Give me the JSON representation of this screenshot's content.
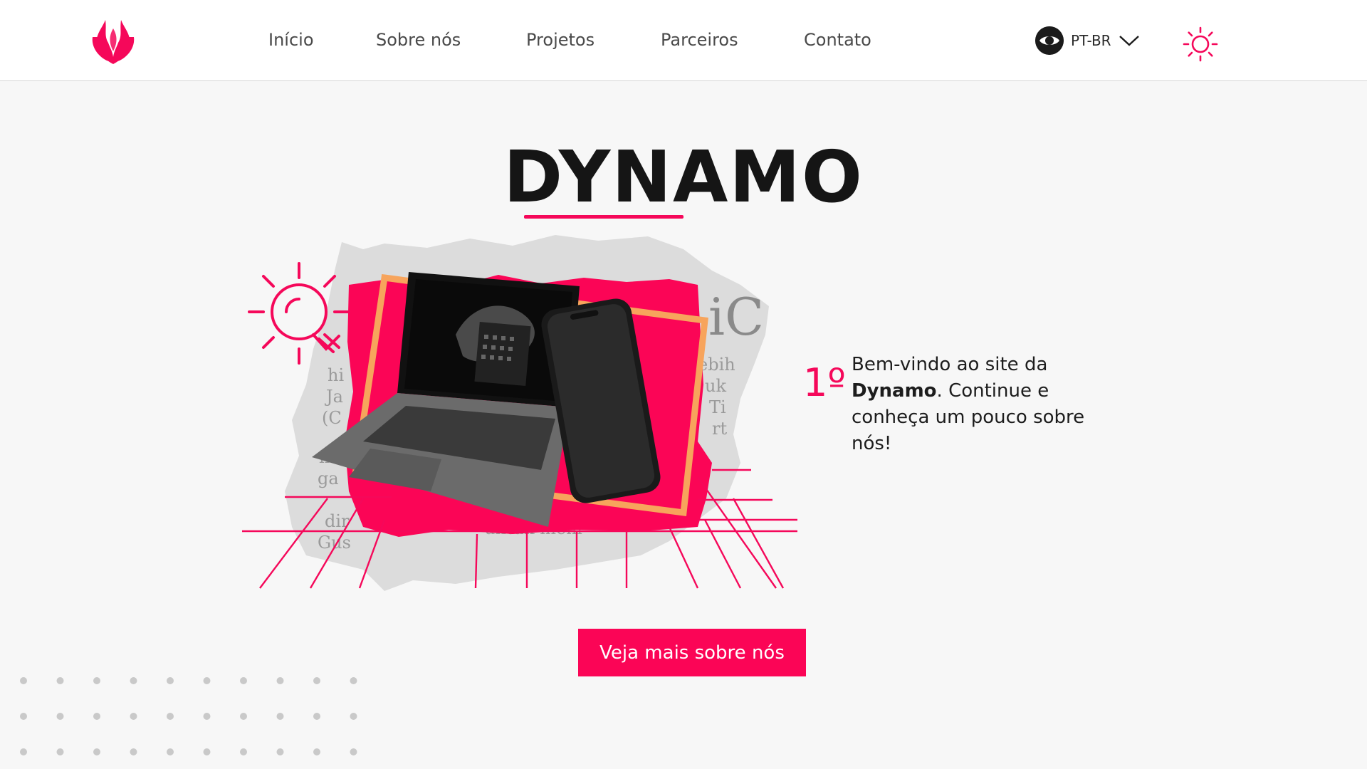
{
  "nav": {
    "logo_icon": "flame-logo-icon",
    "links": [
      "Início",
      "Sobre nós",
      "Projetos",
      "Parceiros",
      "Contato"
    ],
    "language": {
      "label": "PT-BR",
      "icon": "eye-flag-icon",
      "chevron": "chevron-down-icon"
    },
    "theme_icon": "sun-icon"
  },
  "hero": {
    "title": "DYNAMO"
  },
  "feature": {
    "number": "1º",
    "text_before": "Bem-vindo ao site da ",
    "text_bold": "Dynamo",
    "text_after": ". Continue e conheça um pouco sobre nós!"
  },
  "cta": {
    "label": "Veja mais sobre nós"
  },
  "colors": {
    "accent": "#f5085a",
    "button": "#fb0556",
    "orange": "#f7a45c",
    "background": "#f7f7f7",
    "dots": "#c9c9c9"
  }
}
